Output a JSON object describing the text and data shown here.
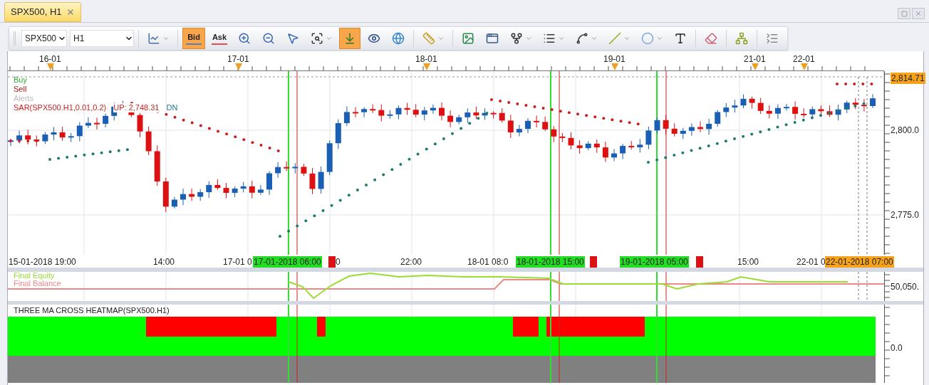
{
  "tabs": [
    {
      "label": "SPX500, H1",
      "selected": true
    }
  ],
  "toolbar": {
    "symbol": "SPX500",
    "timeframe": "H1",
    "price_buttons": [
      {
        "label": "Bid",
        "selected": true,
        "color": "#5a7fb0"
      },
      {
        "label": "Ask",
        "selected": false,
        "color": "#e05050"
      }
    ],
    "tools": [
      {
        "kind": "chart-type",
        "dropdown": true,
        "selected": false
      },
      {
        "kind": "sep"
      },
      {
        "kind": "zoom-in",
        "dropdown": false,
        "selected": false
      },
      {
        "kind": "zoom-out",
        "dropdown": false,
        "selected": false
      },
      {
        "kind": "cursor",
        "dropdown": false,
        "selected": false
      },
      {
        "kind": "zoom-range",
        "dropdown": true,
        "selected": false
      },
      {
        "kind": "autoscroll",
        "dropdown": false,
        "selected": true
      },
      {
        "kind": "eye",
        "dropdown": false,
        "selected": false
      },
      {
        "kind": "globe",
        "dropdown": false,
        "selected": false
      },
      {
        "kind": "sep"
      },
      {
        "kind": "ruler",
        "dropdown": true,
        "selected": false
      },
      {
        "kind": "sep"
      },
      {
        "kind": "image",
        "dropdown": false,
        "selected": false
      },
      {
        "kind": "window",
        "dropdown": false,
        "selected": false
      },
      {
        "kind": "fork",
        "dropdown": true,
        "selected": false
      },
      {
        "kind": "list",
        "dropdown": true,
        "selected": false
      },
      {
        "kind": "fan",
        "dropdown": true,
        "selected": false
      },
      {
        "kind": "line",
        "dropdown": true,
        "selected": false
      },
      {
        "kind": "ellipse",
        "dropdown": true,
        "selected": false
      },
      {
        "kind": "text",
        "dropdown": false,
        "selected": false
      },
      {
        "kind": "sep"
      },
      {
        "kind": "eraser",
        "dropdown": false,
        "selected": false
      },
      {
        "kind": "sep"
      },
      {
        "kind": "tree",
        "dropdown": false,
        "selected": false
      },
      {
        "kind": "sep"
      },
      {
        "kind": "more",
        "dropdown": false,
        "selected": false
      }
    ]
  },
  "top_axis": [
    "16-01",
    "17-01",
    "18-01",
    "19-01",
    "21-01",
    "22-01"
  ],
  "legend": [
    {
      "label": "Buy",
      "color": "#33aa33"
    },
    {
      "label": "Sell",
      "color": "#aa1111"
    },
    {
      "label": "Alerts",
      "color": "#bbbbbb"
    }
  ],
  "sar_legend": {
    "name": "SAR(SPX500.H1,0.01,0.2)",
    "up": "UP: 2,748.31",
    "dn": "DN"
  },
  "price_axis": [
    {
      "label": "2,814.71",
      "kind": "current"
    },
    {
      "label": "2,800.0",
      "kind": "tick"
    },
    {
      "label": "2,775.0",
      "kind": "tick"
    }
  ],
  "time_axis": [
    {
      "label": "15-01-2018 19:00",
      "kind": "tick"
    },
    {
      "label": "14:00",
      "kind": "tick"
    },
    {
      "label": "17-01 0",
      "kind": "tick"
    },
    {
      "label": "17-01-2018 06:00",
      "kind": "buy"
    },
    {
      "kind": "sell"
    },
    {
      "label": "0",
      "kind": "tick"
    },
    {
      "label": "22:00",
      "kind": "tick"
    },
    {
      "label": "18-01 08:0",
      "kind": "tick"
    },
    {
      "label": "18-01-2018 15:00",
      "kind": "buy"
    },
    {
      "kind": "sell"
    },
    {
      "label": "19-01-2018 05:00",
      "kind": "buy"
    },
    {
      "kind": "sell"
    },
    {
      "label": "15:00",
      "kind": "tick"
    },
    {
      "label": "22-01 0",
      "kind": "tick"
    },
    {
      "label": "22-01-2018 07:00",
      "kind": "current"
    }
  ],
  "equity_panel": {
    "legend": [
      {
        "label": "Final Equity",
        "color": "#99dd33"
      },
      {
        "label": "Final Balance",
        "color": "#ee8888"
      }
    ],
    "axis": "50,050."
  },
  "heatmap_panel": {
    "title": "THREE MA CROSS HEATMAP(SPX500.H1)",
    "axis": "0.0"
  }
}
